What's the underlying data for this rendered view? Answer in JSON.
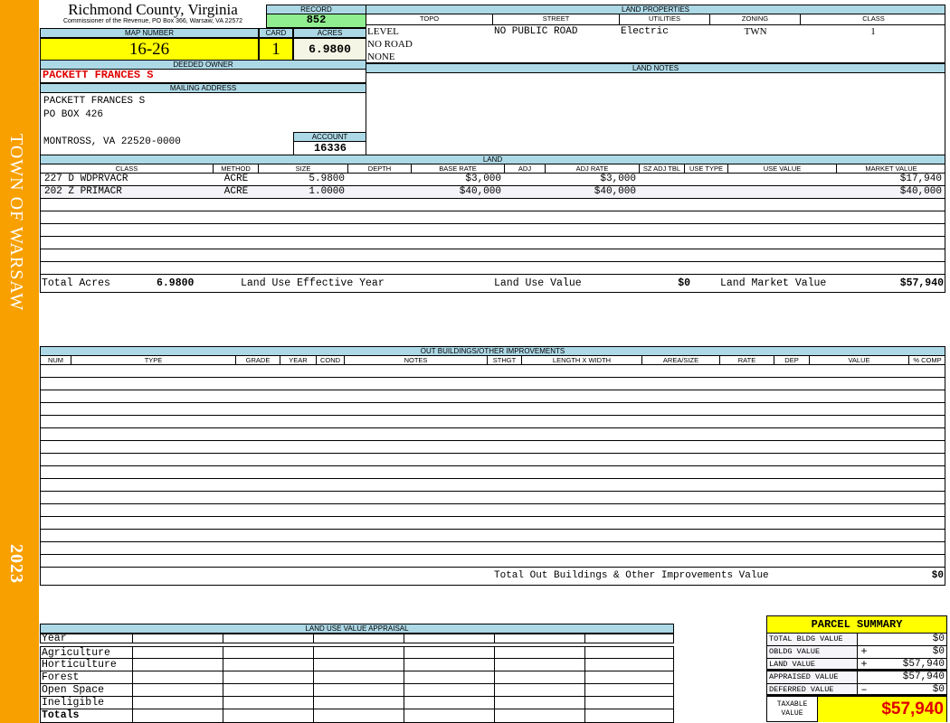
{
  "side": {
    "town": "TOWN OF WARSAW",
    "year": "2023"
  },
  "header": {
    "county": "Richmond County, Virginia",
    "sub": "Commissioner of the Revenue, PO Box 366, Warsaw, VA 22572"
  },
  "record": {
    "label": "RECORD",
    "value": "852"
  },
  "map": {
    "label": "MAP NUMBER",
    "value": "16-26"
  },
  "card": {
    "label": "CARD",
    "value": "1"
  },
  "acres": {
    "label": "ACRES",
    "value": "6.9800"
  },
  "owner": {
    "label": "DEEDED OWNER",
    "value": "PACKETT FRANCES S"
  },
  "mailing": {
    "label": "MAILING ADDRESS",
    "lines": [
      "PACKETT FRANCES S",
      "PO BOX 426",
      "",
      "MONTROSS, VA 22520-0000"
    ]
  },
  "account": {
    "label": "ACCOUNT",
    "value": "16336"
  },
  "land_properties": {
    "label": "LAND PROPERTIES",
    "headers": [
      "TOPO",
      "STREET",
      "UTILITIES",
      "ZONING",
      "CLASS"
    ],
    "topo": [
      "LEVEL",
      "NO ROAD",
      "NONE"
    ],
    "street": "NO PUBLIC ROAD",
    "utilities": "Electric",
    "zoning": "TWN",
    "class": "1"
  },
  "land_notes": {
    "label": "LAND NOTES"
  },
  "land": {
    "label": "LAND",
    "headers": [
      "CLASS",
      "METHOD",
      "SIZE",
      "DEPTH",
      "BASE RATE",
      "ADJ",
      "ADJ RATE",
      "SZ ADJ TBL",
      "USE TYPE",
      "USE VALUE",
      "MARKET VALUE"
    ],
    "rows": [
      [
        "227 D WDPRVACR",
        "ACRE",
        "5.9800",
        "",
        "$3,000",
        "",
        "$3,000",
        "",
        "",
        "",
        "$17,940"
      ],
      [
        "202 Z PRIMACR",
        "ACRE",
        "1.0000",
        "",
        "$40,000",
        "",
        "$40,000",
        "",
        "",
        "",
        "$40,000"
      ]
    ],
    "totals": {
      "acres_label": "Total Acres",
      "acres": "6.9800",
      "effyear_label": "Land Use Effective Year",
      "luv_label": "Land Use Value",
      "luv": "$0",
      "lmv_label": "Land Market Value",
      "lmv": "$57,940"
    }
  },
  "outbuildings": {
    "label": "OUT BUILDINGS/OTHER IMPROVEMENTS",
    "headers": [
      "NUM",
      "TYPE",
      "GRADE",
      "YEAR",
      "COND",
      "NOTES",
      "STHGT",
      "LENGTH X WIDTH",
      "AREA/SIZE",
      "RATE",
      "DEP",
      "VALUE",
      "% COMP"
    ],
    "total_label": "Total Out Buildings & Other Improvements Value",
    "total": "$0"
  },
  "luva": {
    "label": "LAND USE VALUE APPRAISAL",
    "year_label": "Year",
    "rows": [
      "Agriculture",
      "Horticulture",
      "Forest",
      "Open Space",
      "Ineligible"
    ],
    "totals_label": "Totals"
  },
  "summary": {
    "title": "PARCEL SUMMARY",
    "rows": [
      {
        "label": "TOTAL BLDG VALUE",
        "op": "",
        "value": "$0"
      },
      {
        "label": "OBLDG VALUE",
        "op": "+",
        "value": "$0"
      },
      {
        "label": "LAND VALUE",
        "op": "+",
        "value": "$57,940"
      },
      {
        "label": "APPRAISED VALUE",
        "op": "",
        "value": "$57,940"
      },
      {
        "label": "DEFERRED VALUE",
        "op": "–",
        "value": "$0"
      }
    ],
    "taxable_label": "TAXABLE VALUE",
    "taxable": "$57,940"
  },
  "colors": {
    "side": "#f7a000",
    "label_bg": "#add8e6",
    "highlight": "#ffff00",
    "record": "#90ee90",
    "owner": "#e00000"
  }
}
